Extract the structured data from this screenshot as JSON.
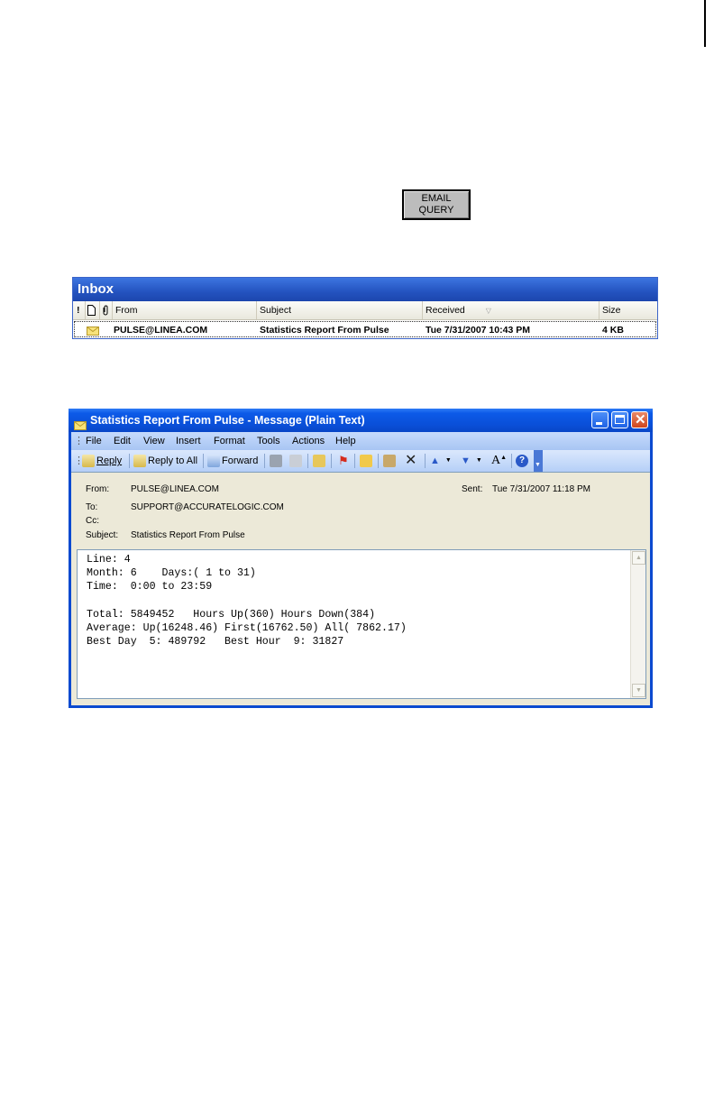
{
  "email_query_button": {
    "line1": "EMAIL",
    "line2": "QUERY"
  },
  "inbox": {
    "title": "Inbox",
    "columns": {
      "from": "From",
      "subject": "Subject",
      "received": "Received",
      "size": "Size"
    },
    "rows": [
      {
        "from": "PULSE@LINEA.COM",
        "subject": "Statistics Report From Pulse",
        "received": "Tue 7/31/2007 10:43 PM",
        "size": "4 KB"
      }
    ]
  },
  "message_window": {
    "title": "Statistics Report From Pulse - Message (Plain Text)",
    "menu": [
      "File",
      "Edit",
      "View",
      "Insert",
      "Format",
      "Tools",
      "Actions",
      "Help"
    ],
    "toolbar": {
      "reply": "Reply",
      "reply_all": "Reply to All",
      "forward": "Forward"
    },
    "header": {
      "from_label": "From:",
      "from_value": "PULSE@LINEA.COM",
      "sent_label": "Sent:",
      "sent_value": "Tue 7/31/2007 11:18 PM",
      "to_label": "To:",
      "to_value": "SUPPORT@ACCURATELOGIC.COM",
      "cc_label": "Cc:",
      "cc_value": "",
      "subject_label": "Subject:",
      "subject_value": "Statistics Report From Pulse"
    },
    "body_lines": [
      "Line: 4",
      "Month: 6    Days:( 1 to 31)",
      "Time:  0:00 to 23:59",
      "",
      "Total: 5849452   Hours Up(360) Hours Down(384)",
      "Average: Up(16248.46) First(16762.50) All( 7862.17)",
      "Best Day  5: 489792   Best Hour  9: 31827"
    ]
  },
  "colors": {
    "title_blue": "#0a4fd8",
    "inbox_blue": "#2453c0",
    "window_bg": "#ece9d8"
  }
}
